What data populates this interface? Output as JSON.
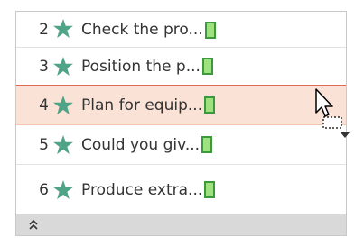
{
  "animation_pane": {
    "items": [
      {
        "number": "2",
        "label": "Check the pro...",
        "icon": "star-icon"
      },
      {
        "number": "3",
        "label": "Position the p...",
        "icon": "star-icon"
      },
      {
        "number": "4",
        "label": "Plan for equip...",
        "icon": "star-icon"
      },
      {
        "number": "5",
        "label": "Could you giv...",
        "icon": "star-icon"
      },
      {
        "number": "6",
        "label": "Produce extra...",
        "icon": "star-icon"
      }
    ],
    "selected_index": 2,
    "collapse_icon": "double-chevron-up-icon"
  },
  "colors": {
    "star": "#4fa386",
    "timing_bar_fill": "#9fe07f",
    "timing_bar_border": "#3c9a3c",
    "selected_row": "#fbe2d6",
    "drop_indicator": "#e06b55",
    "bottom_bar": "#d9d9d9"
  }
}
